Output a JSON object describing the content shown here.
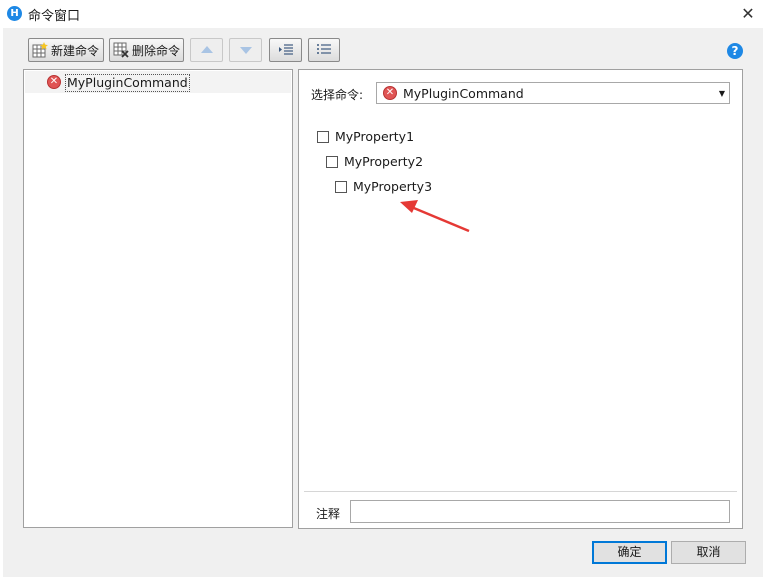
{
  "window": {
    "title": "命令窗口",
    "app_icon_glyph": "H"
  },
  "toolbar": {
    "new_command_label": "新建命令",
    "delete_command_label": "删除命令"
  },
  "tree": {
    "items": [
      {
        "label": "MyPluginCommand",
        "status": "error"
      }
    ]
  },
  "detail": {
    "select_label": "选择命令:",
    "select_value": "MyPluginCommand",
    "properties": [
      {
        "label": "MyProperty1",
        "checked": false
      },
      {
        "label": "MyProperty2",
        "checked": false
      },
      {
        "label": "MyProperty3",
        "checked": false
      }
    ],
    "comment_label": "注释",
    "comment_value": ""
  },
  "footer": {
    "ok_label": "确定",
    "cancel_label": "取消"
  },
  "colors": {
    "annotation_arrow": "#e53935",
    "accent": "#0078d7",
    "error": "#e05555"
  }
}
